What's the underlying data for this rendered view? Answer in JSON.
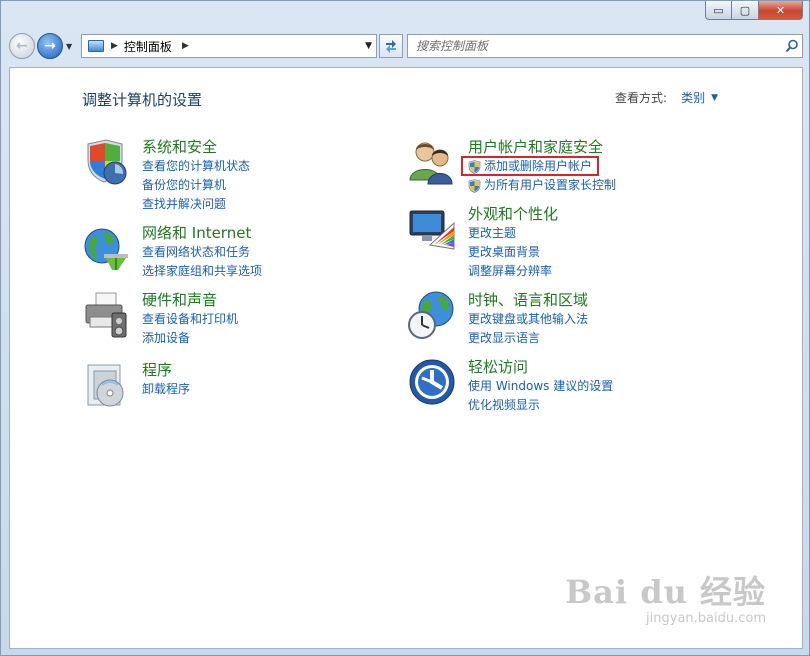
{
  "window": {
    "caption": {
      "minimize": "▭",
      "maximize": "▢",
      "close": "✕"
    }
  },
  "navbar": {
    "back_label": "←",
    "forward_label": "→",
    "address": {
      "path": [
        "控制面板"
      ]
    },
    "search": {
      "placeholder": "搜索控制面板"
    }
  },
  "header": {
    "title": "调整计算机的设置",
    "view_by_label": "查看方式:",
    "view_by_value": "类别"
  },
  "categories": [
    {
      "title": "系统和安全",
      "icon": "system-security-icon",
      "links": [
        "查看您的计算机状态",
        "备份您的计算机",
        "查找并解决问题"
      ]
    },
    {
      "title": "网络和 Internet",
      "icon": "network-internet-icon",
      "links": [
        "查看网络状态和任务",
        "选择家庭组和共享选项"
      ]
    },
    {
      "title": "硬件和声音",
      "icon": "hardware-sound-icon",
      "links": [
        "查看设备和打印机",
        "添加设备"
      ]
    },
    {
      "title": "程序",
      "icon": "programs-icon",
      "links": [
        "卸载程序"
      ]
    },
    {
      "title": "用户帐户和家庭安全",
      "icon": "user-accounts-icon",
      "links": [
        "添加或删除用户帐户",
        "为所有用户设置家长控制"
      ]
    },
    {
      "title": "外观和个性化",
      "icon": "appearance-icon",
      "links": [
        "更改主题",
        "更改桌面背景",
        "调整屏幕分辨率"
      ]
    },
    {
      "title": "时钟、语言和区域",
      "icon": "clock-language-region-icon",
      "links": [
        "更改键盘或其他输入法",
        "更改显示语言"
      ]
    },
    {
      "title": "轻松访问",
      "icon": "ease-of-access-icon",
      "links": [
        "使用 Windows 建议的设置",
        "优化视频显示"
      ]
    }
  ],
  "watermark": {
    "line1": "Bai du 经验",
    "line2": "jingyan.baidu.com"
  },
  "colors": {
    "category_title": "#1f7a1f",
    "link": "#1a5fb4",
    "highlight": "#d9232e"
  }
}
